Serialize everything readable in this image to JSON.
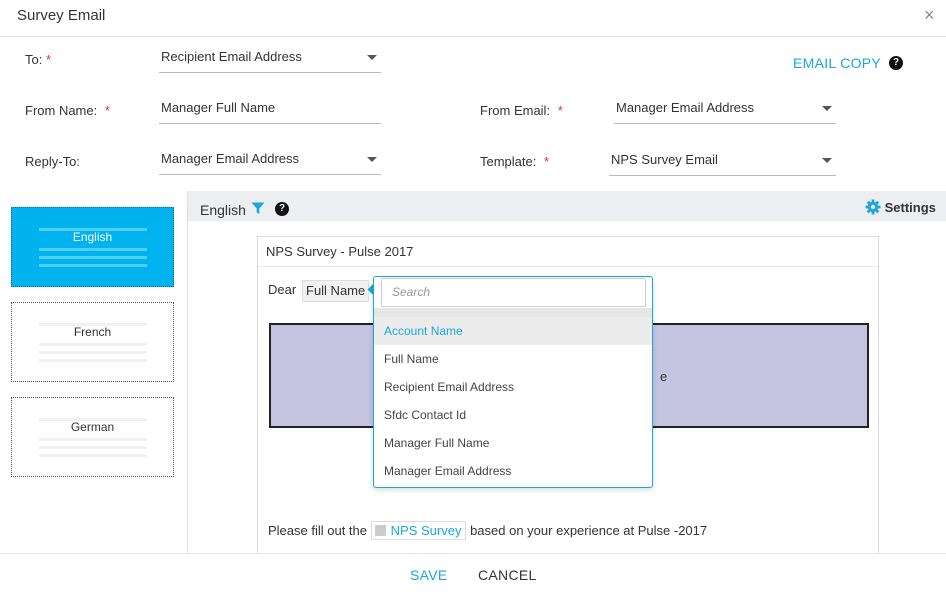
{
  "dialog": {
    "title": "Survey Email",
    "close_glyph": "×"
  },
  "form": {
    "to_label": "To:",
    "to_value": "Recipient Email Address",
    "from_name_label": "From Name:",
    "from_name_value": "Manager Full Name",
    "from_email_label": "From Email:",
    "from_email_value": "Manager Email Address",
    "reply_to_label": "Reply-To:",
    "reply_to_value": "Manager Email Address",
    "template_label": "Template:",
    "template_value": "NPS Survey Email",
    "required_mark": "*",
    "email_copy": "EMAIL COPY",
    "help_glyph": "?"
  },
  "languages": [
    {
      "label": "English",
      "active": true
    },
    {
      "label": "French",
      "active": false
    },
    {
      "label": "German",
      "active": false
    }
  ],
  "editor": {
    "language": "English",
    "settings_label": "Settings",
    "subject": "NPS Survey - Pulse 2017",
    "dear": "Dear",
    "token": "Full Name",
    "banner_text_fragment": "e",
    "body_prefix": "Please fill out the",
    "body_chip": "NPS Survey",
    "body_suffix": "based on your experience at Pulse -2017"
  },
  "dropdown": {
    "placeholder": "Search",
    "options": [
      "Account Name",
      "Full Name",
      "Recipient Email Address",
      "Sfdc Contact Id",
      "Manager Full Name",
      "Manager Email Address"
    ],
    "highlighted": "Account Name"
  },
  "footer": {
    "save": "SAVE",
    "cancel": "CANCEL"
  },
  "colors": {
    "accent": "#19a8d9",
    "active_card": "#00b2ee",
    "banner": "#c6c3e0",
    "required": "#e0352b"
  },
  "icons": [
    "close-icon",
    "help-icon",
    "filter-icon",
    "gear-icon",
    "caret-down-icon"
  ]
}
